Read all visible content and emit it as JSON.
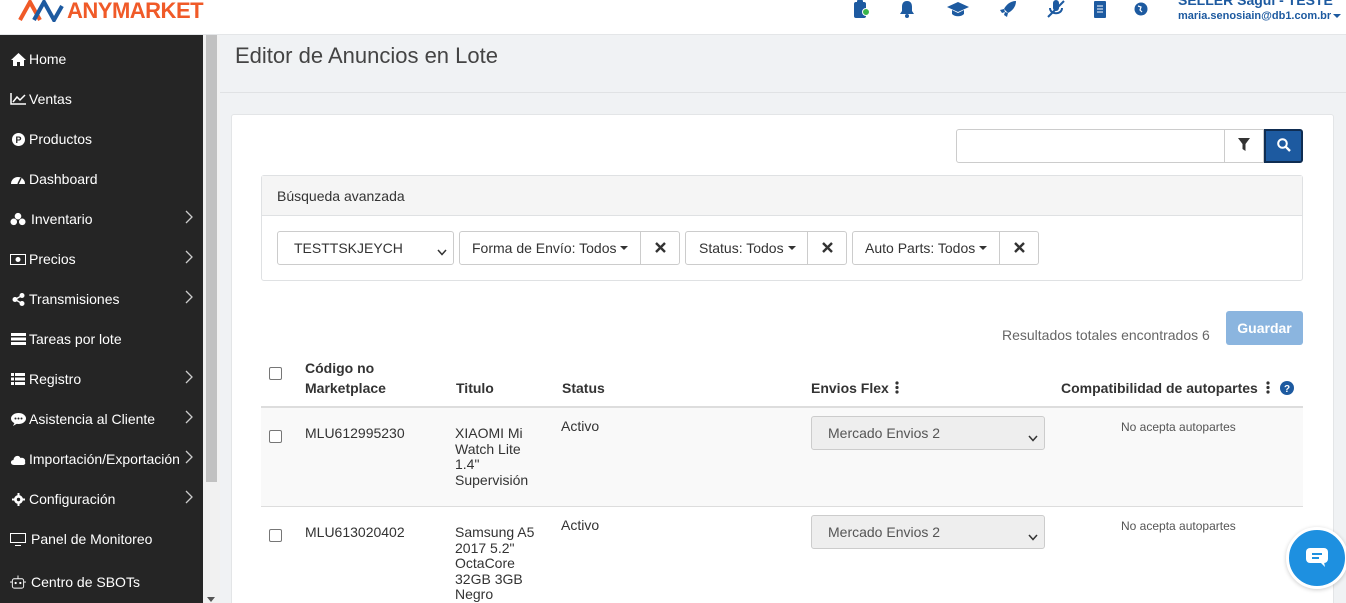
{
  "brand": {
    "name": "ANYMARKET",
    "color": "#f05a28"
  },
  "topbar": {
    "icons": [
      "clipboard-icon",
      "bell-icon",
      "graduation-cap-icon",
      "rocket-icon",
      "microphone-slash-icon",
      "document-icon",
      "globe-icon"
    ],
    "user_name": "SELLER Sagui - TESTE",
    "user_email": "maria.senosiain@db1.com.br"
  },
  "sidebar": {
    "items": [
      {
        "label": "Home",
        "icon": "home-icon",
        "has_children": false
      },
      {
        "label": "Ventas",
        "icon": "line-chart-icon",
        "has_children": false
      },
      {
        "label": "Productos",
        "icon": "product-icon",
        "has_children": false
      },
      {
        "label": "Dashboard",
        "icon": "dashboard-icon",
        "has_children": false
      },
      {
        "label": "Inventario",
        "icon": "cubes-icon",
        "has_children": true
      },
      {
        "label": "Precios",
        "icon": "money-icon",
        "has_children": true
      },
      {
        "label": "Transmisiones",
        "icon": "share-icon",
        "has_children": true
      },
      {
        "label": "Tareas por lote",
        "icon": "tasks-icon",
        "has_children": false
      },
      {
        "label": "Registro",
        "icon": "list-icon",
        "has_children": true
      },
      {
        "label": "Asistencia al Cliente",
        "icon": "chat-bubble-icon",
        "has_children": true
      },
      {
        "label": "Importación/Exportación",
        "icon": "cloud-icon",
        "has_children": true
      },
      {
        "label": "Configuración",
        "icon": "gear-icon",
        "has_children": true
      },
      {
        "label": "Panel de Monitoreo",
        "icon": "monitor-icon",
        "has_children": false
      },
      {
        "label": "Centro de SBOTs",
        "icon": "robot-icon",
        "has_children": false
      }
    ]
  },
  "main": {
    "title": "Editor de Anuncios en Lote",
    "search": {
      "value": "",
      "placeholder": ""
    },
    "advanced": {
      "title": "Búsqueda avanzada",
      "account_select": "TESTTSKJEYCH",
      "filters": [
        "Forma de Envío: Todos",
        "Status: Todos",
        "Auto Parts: Todos"
      ]
    },
    "results_label": "Resultados totales encontrados 6",
    "save_label": "Guardar",
    "table": {
      "headers": {
        "code": "Código no Marketplace",
        "title": "Titulo",
        "status": "Status",
        "flex": "Envios Flex",
        "compat": "Compatibilidad de autopartes"
      },
      "rows": [
        {
          "code": "MLU612995230",
          "title_lines": [
            "XIAOMI Mi",
            "Watch Lite",
            "1.4\"",
            "Supervisión"
          ],
          "status": "Activo",
          "flex": "Mercado Envios 2",
          "compat": "No acepta autopartes"
        },
        {
          "code": "MLU613020402",
          "title_lines": [
            "Samsung A5",
            "2017 5.2\"",
            "OctaCore",
            "32GB 3GB",
            "Negro"
          ],
          "status": "Activo",
          "flex": "Mercado Envios 2",
          "compat": "No acepta autopartes"
        }
      ]
    }
  },
  "colors": {
    "primary": "#1d5aa0",
    "sidebar_bg": "#252525",
    "save_disabled": "#8bb5df",
    "chat": "#1e90e0"
  }
}
